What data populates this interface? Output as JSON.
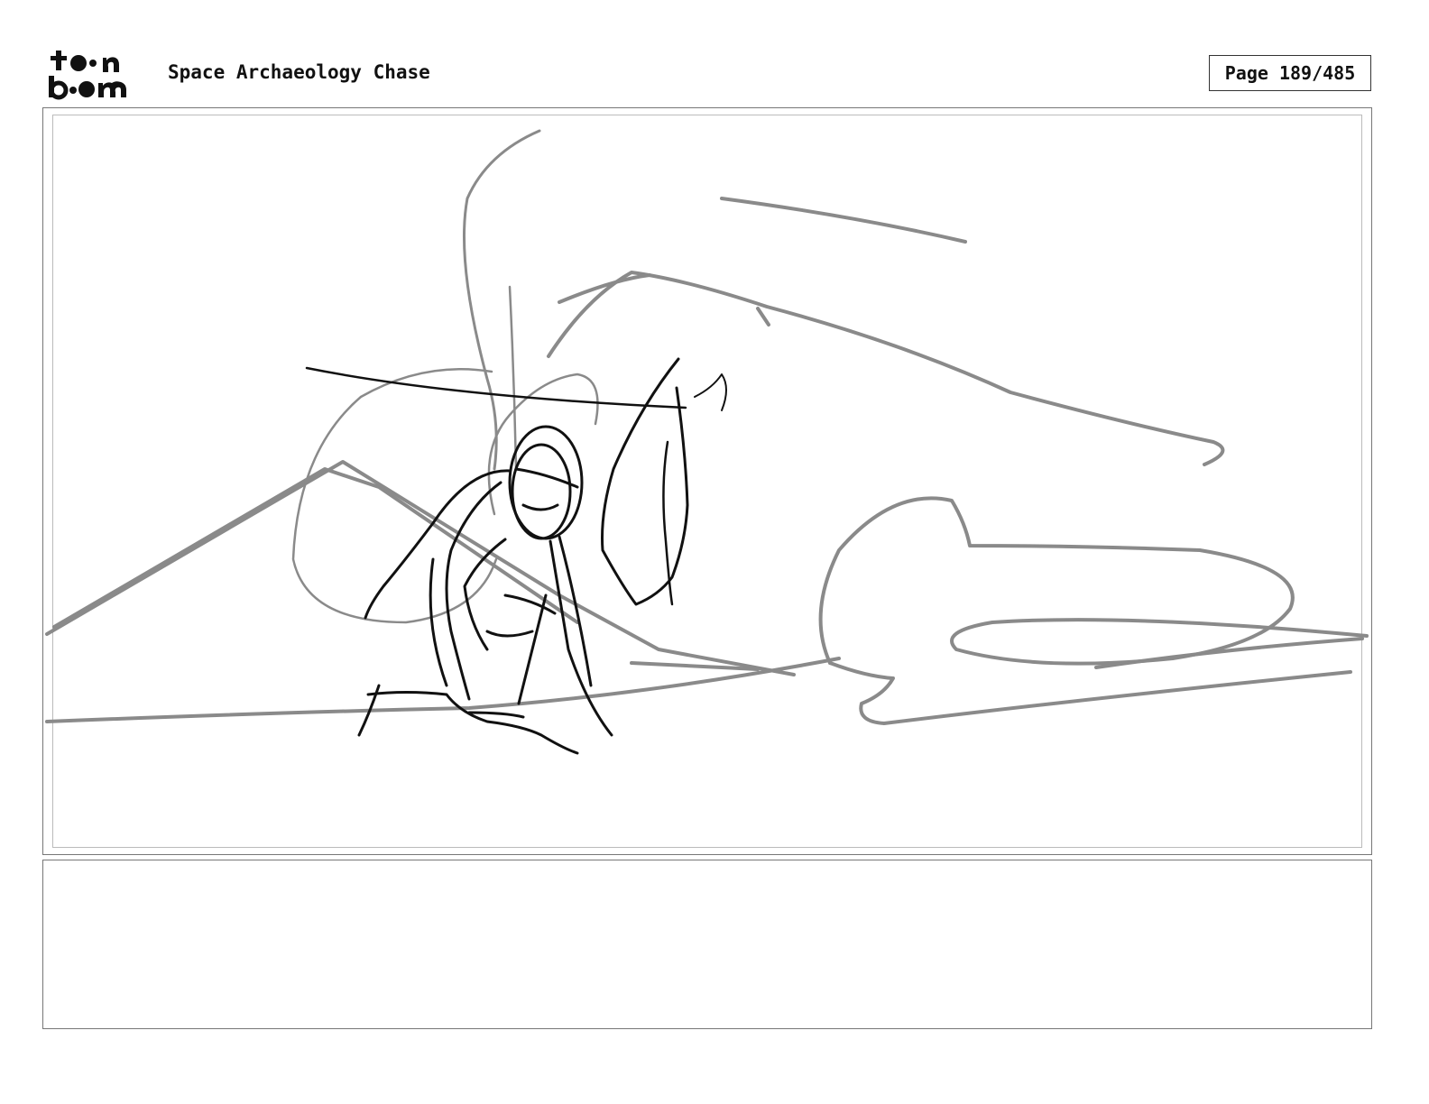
{
  "header": {
    "logo_text": "toon boom",
    "project_title": "Space Archaeology Chase",
    "page_label": "Page 189/485"
  },
  "panel": {
    "sketch_description": "Rough storyboard sketch: figure crouching in front of rocky landscape",
    "notes_text": ""
  },
  "colors": {
    "sketch_dark": "#111111",
    "sketch_gray": "#8a8a8a",
    "frame_border": "#777777"
  }
}
